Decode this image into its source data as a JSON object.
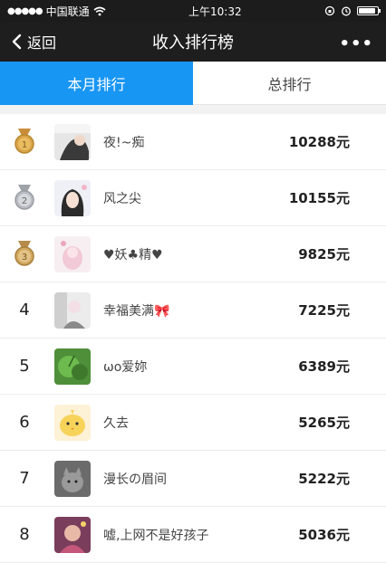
{
  "status_bar": {
    "carrier": "中国联通",
    "time": "上午10:32",
    "signal": "●●●●●"
  },
  "nav": {
    "back_label": "返回",
    "title": "收入排行榜",
    "more": "•••"
  },
  "tabs": [
    {
      "label": "本月排行"
    },
    {
      "label": "总排行"
    }
  ],
  "battery_level": 0.9,
  "rankings": [
    {
      "rank": "1",
      "name": "夜!~痴",
      "amount": "10288元",
      "medal": "gold"
    },
    {
      "rank": "2",
      "name": "风之尖",
      "amount": "10155元",
      "medal": "silver"
    },
    {
      "rank": "3",
      "name": "♥妖♣精♥",
      "amount": "9825元",
      "medal": "bronze"
    },
    {
      "rank": "4",
      "name": "幸福美满🎀",
      "amount": "7225元"
    },
    {
      "rank": "5",
      "name": "ωo爱妳",
      "amount": "6389元"
    },
    {
      "rank": "6",
      "name": "久去",
      "amount": "5265元"
    },
    {
      "rank": "7",
      "name": "漫长の眉间",
      "amount": "5222元"
    },
    {
      "rank": "8",
      "name": "嘘,上网不是好孩子",
      "amount": "5036元"
    }
  ],
  "colors": {
    "tab_active": "#1896f3",
    "gold": "#d9a54a",
    "silver": "#b9bcc2",
    "bronze": "#d1a760"
  }
}
